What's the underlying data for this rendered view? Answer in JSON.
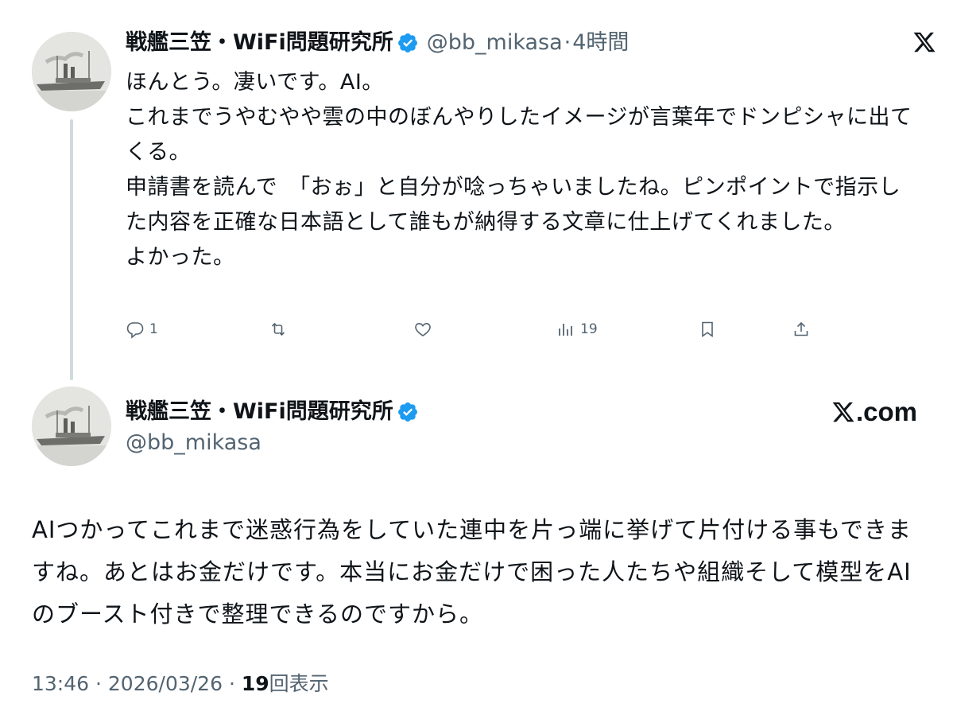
{
  "colors": {
    "text_primary": "#0f1419",
    "text_secondary": "#536471",
    "verified_blue": "#1d9bf0",
    "thread_line": "#cfd9de"
  },
  "reply_tweet": {
    "display_name": "戦艦三笠・WiFi問題研究所",
    "handle": "@bb_mikasa",
    "separator": "·",
    "time_ago": "4時間",
    "text": "ほんとう。凄いです。AI。\nこれまでうやむやや雲の中のぼんやりしたイメージが言葉年でドンピシャに出てくる。\n申請書を読んで　「おぉ」と自分が唸っちゃいましたね。ピンポイントで指示した内容を正確な日本語として誰もが納得する文章に仕上げてくれました。\nよかった。",
    "actions": {
      "reply_count": "1",
      "retweet_count": "",
      "like_count": "",
      "views_count": "19"
    },
    "icons": [
      "verified-icon",
      "x-logo-icon",
      "reply-icon",
      "retweet-icon",
      "like-icon",
      "views-icon",
      "bookmark-icon",
      "share-icon"
    ]
  },
  "main_tweet": {
    "display_name": "戦艦三笠・WiFi問題研究所",
    "handle": "@bb_mikasa",
    "brand": ".com",
    "text": "AIつかってこれまで迷惑行為をしていた連中を片っ端に挙げて片付ける事もできますね。あとはお金だけです。本当にお金だけで困った人たちや組織そして模型をAIのブースト付きで整理できるのですから。",
    "timestamp_time": "13:46",
    "timestamp_sep1": "·",
    "timestamp_date": "2026/03/26",
    "timestamp_sep2": "·",
    "views_number": "19",
    "views_label": "回表示"
  }
}
